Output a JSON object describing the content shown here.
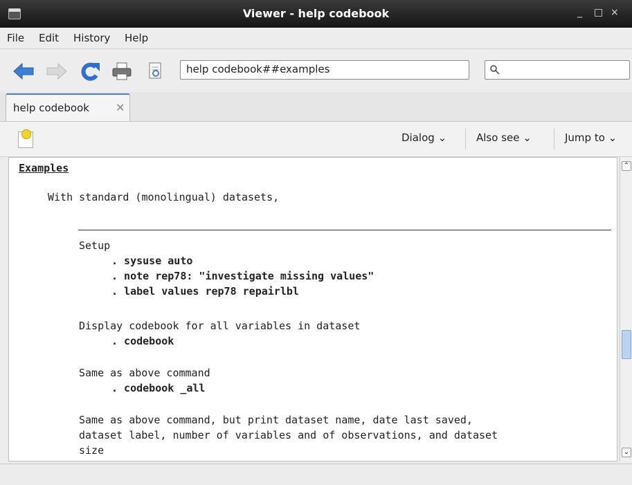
{
  "window": {
    "title": "Viewer - help codebook",
    "controls": [
      "_",
      "□",
      "×"
    ]
  },
  "menu": [
    "File",
    "Edit",
    "History",
    "Help"
  ],
  "toolbar": {
    "url": "help codebook##examples",
    "search_placeholder": ""
  },
  "tab": {
    "label": "help codebook",
    "close": "✕"
  },
  "subtoolbar": {
    "dialog": "Dialog",
    "also_see": "Also see",
    "jump_to": "Jump to"
  },
  "content": {
    "heading": "Examples",
    "intro": "With standard (monolingual) datasets,",
    "setup_label": "Setup",
    "setup_cmds": [
      ". sysuse auto",
      ". note rep78: \"investigate missing values\"",
      ". label values rep78 repairlbl"
    ],
    "ex1_desc": "Display codebook for all variables in dataset",
    "ex1_cmd": ". codebook",
    "ex2_desc": "Same as above command",
    "ex2_cmd": ". codebook _all",
    "ex3_desc": [
      "Same as above command, but print dataset name, date last saved,",
      "dataset label, number of variables and of observations, and dataset",
      "size"
    ]
  },
  "colors": {
    "accent": "#4a7ec8",
    "title_bar": "#1c1c1c",
    "back_arrow": "#3d7fd6",
    "reload": "#2f6fd1"
  }
}
